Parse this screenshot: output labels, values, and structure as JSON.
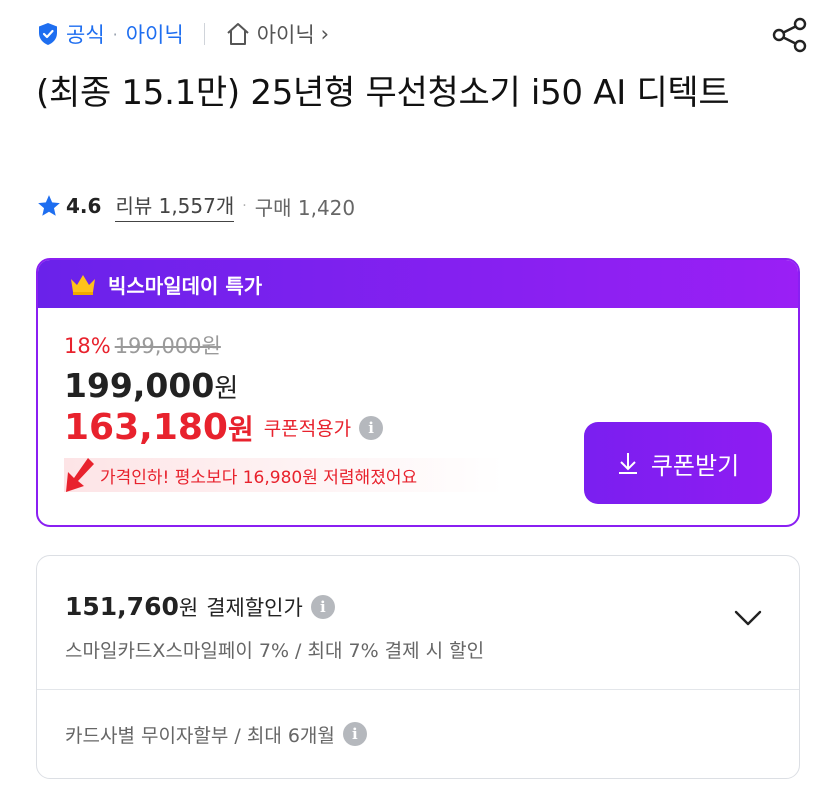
{
  "header": {
    "official_label": "공식",
    "brand_label": "아이닉",
    "store_label": "아이닉",
    "store_chevron": "›"
  },
  "product": {
    "title": "(최종 15.1만) 25년형 무선청소기 i50 AI 디텍트",
    "rating": "4.6",
    "review_label": "리뷰 1,557개",
    "purchase_label": "구매 1,420"
  },
  "deal": {
    "banner": "빅스마일데이 특가",
    "discount_pct": "18%",
    "original_price": "199,000원",
    "sale_price_num": "199,000",
    "sale_price_won": "원",
    "coupon_price_num": "163,180",
    "coupon_price_won": "원",
    "coupon_label": "쿠폰적용가",
    "drop_text": "가격인하! 평소보다 16,980원 저렴해졌어요",
    "coupon_button": "쿠폰받기"
  },
  "payment": {
    "price_num": "151,760",
    "price_won": "원",
    "label": "결제할인가",
    "sub": "스마일카드X스마일페이 7% / 최대 7% 결제 시 할인",
    "installment": "카드사별 무이자할부 / 최대 6개월"
  },
  "colors": {
    "accent_blue": "#1e6ef0",
    "deal_purple": "#8a1ff2",
    "price_red": "#e8222d"
  }
}
